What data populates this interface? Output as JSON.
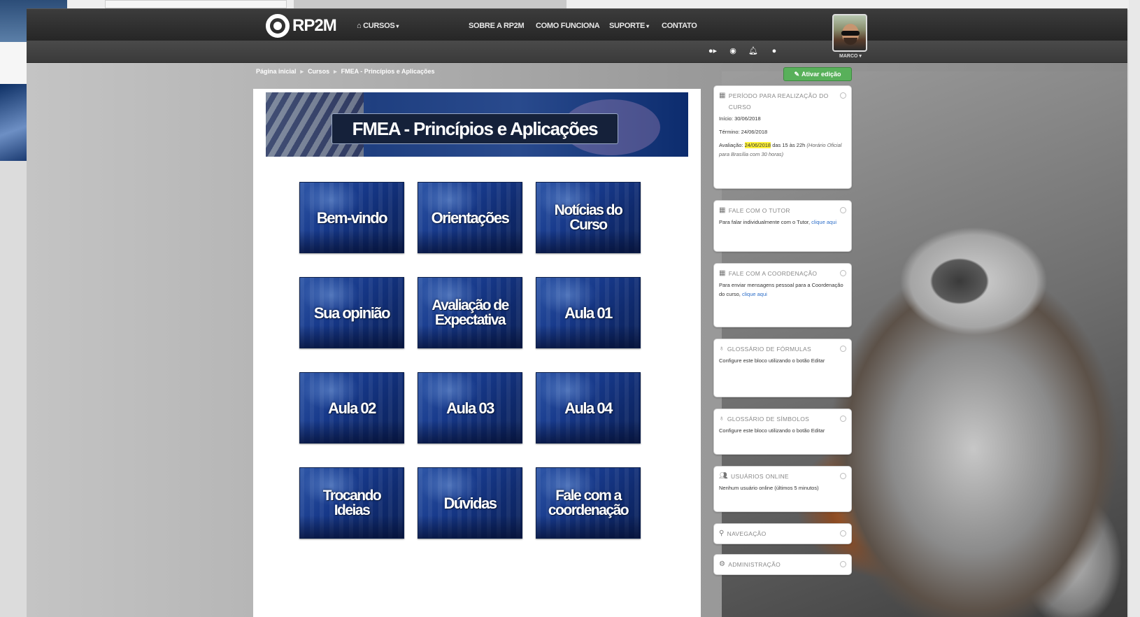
{
  "nav": {
    "logo_text": "RP2M",
    "cursos": "CURSOS",
    "sobre": "SOBRE A RP2M",
    "como": "COMO FUNCIONA",
    "suporte": "SUPORTE",
    "contato": "CONTATO",
    "user_name": "MARCO"
  },
  "breadcrumb": [
    "Página inicial",
    "Cursos",
    "FMEA - Princípios e Aplicações"
  ],
  "edit_button": "Ativar edição",
  "banner_title": "FMEA - Princípios e Aplicações",
  "tiles": [
    "Bem-vindo",
    "Orientações",
    "Notícias do Curso",
    "Sua opinião",
    "Avaliação de Expectativa",
    "Aula 01",
    "Aula 02",
    "Aula 03",
    "Aula 04",
    "Trocando Ideias",
    "Dúvidas",
    "Fale com a coordenação"
  ],
  "sidebar": {
    "periodo": {
      "title": "PERÍODO PARA REALIZAÇÃO DO CURSO",
      "inicio": "Início: 30/06/2018",
      "termino": "Término: 24/06/2018",
      "avaliacao_label": "Avaliação:",
      "avaliacao_date": "24/06/2018",
      "avaliacao_rest": "das 15 às 22h",
      "avaliacao_note": "(Horário Oficial para Brasília com 30 horas)"
    },
    "tutor": {
      "title": "FALE COM O TUTOR",
      "text": "Para falar individualmente com o Tutor,",
      "link": "clique aqui"
    },
    "coordenacao": {
      "title": "FALE COM A COORDENAÇÃO",
      "text": "Para enviar mensagens pessoal para a Coordenação do curso,",
      "link": "clique aqui"
    },
    "glossario_formulas": {
      "title": "GLOSSÁRIO DE FÓRMULAS",
      "text": "Configure este bloco utilizando o botão Editar"
    },
    "glossario_simbolos": {
      "title": "GLOSSÁRIO DE SÍMBOLOS",
      "text": "Configure este bloco utilizando o botão Editar"
    },
    "usuarios": {
      "title": "USUÁRIOS ONLINE",
      "text": "Nenhum usuário online (últimos 5 minutos)"
    },
    "navegacao": {
      "title": "NAVEGAÇÃO"
    },
    "administracao": {
      "title": "ADMINISTRAÇÃO"
    }
  }
}
